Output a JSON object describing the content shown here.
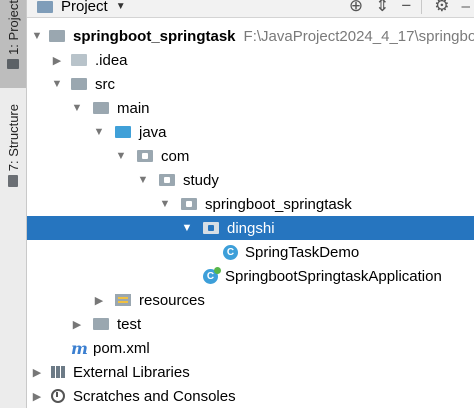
{
  "side_tabs": {
    "project_label": "1: Project",
    "structure_label": "7: Structure"
  },
  "toolbar": {
    "title": "Project",
    "caret": "▼",
    "icons": [
      "locate-icon",
      "collapse-all-icon",
      "settings-icon",
      "hide-icon"
    ]
  },
  "tree": {
    "root": {
      "name": "springboot_springtask",
      "path": "F:\\JavaProject2024_4_17\\springbo"
    },
    "idea": ".idea",
    "src": "src",
    "main": "main",
    "java": "java",
    "com": "com",
    "study": "study",
    "pkg": "springboot_springtask",
    "dingshi": "dingshi",
    "demo_class": "SpringTaskDemo",
    "app_class": "SpringbootSpringtaskApplication",
    "resources": "resources",
    "test": "test",
    "pom": "pom.xml",
    "ext_libs": "External Libraries",
    "scratches": "Scratches and Consoles"
  },
  "colors": {
    "selection": "#2675bf",
    "class_icon": "#3d9fd9"
  }
}
